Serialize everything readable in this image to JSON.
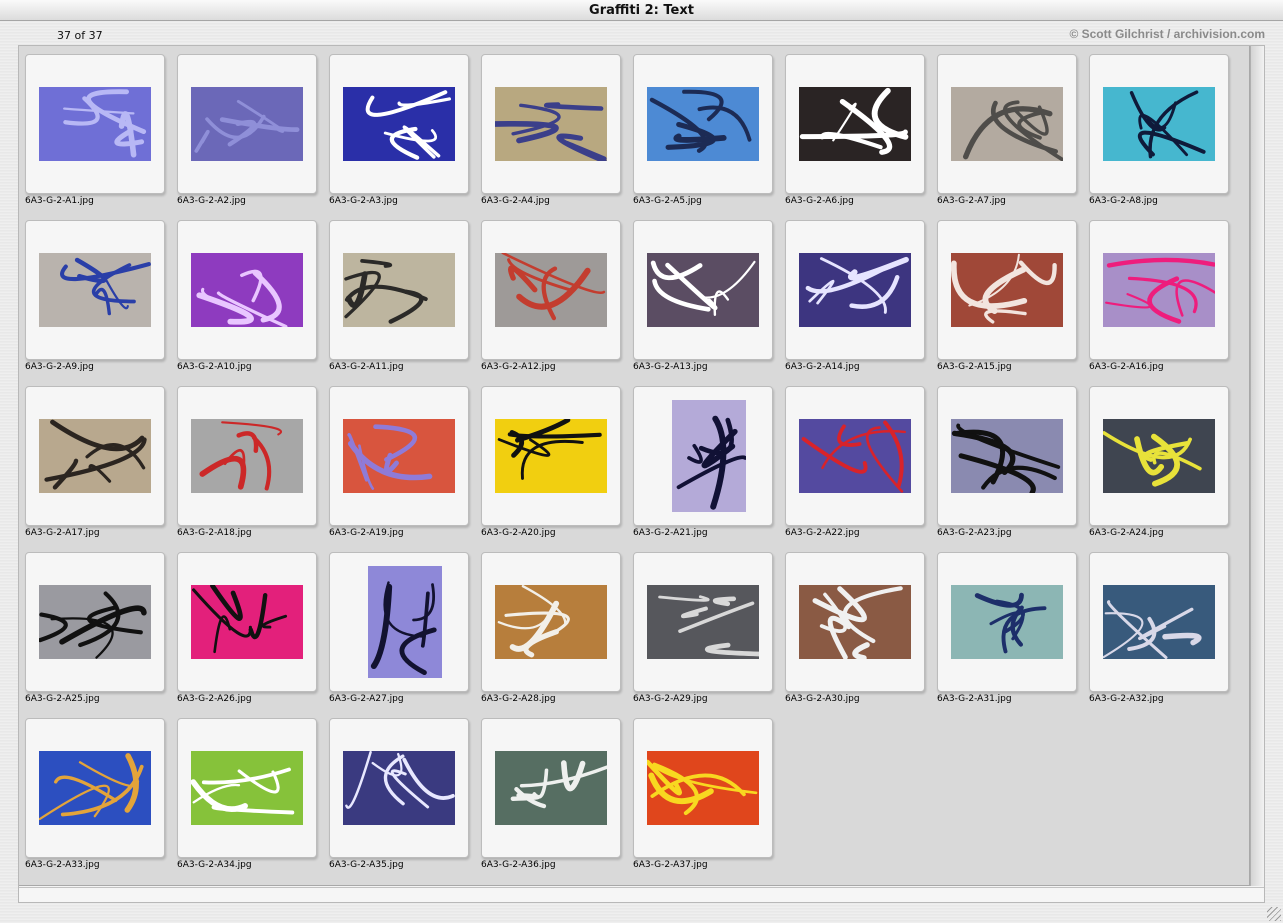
{
  "window": {
    "title": "Graffiti 2: Text"
  },
  "header": {
    "count": "37 of 37",
    "credit": "© Scott Gilchrist / archivision.com"
  },
  "thumbnails": [
    {
      "label": "6A3-G-2-A1.jpg",
      "bg": "#6f6fd6",
      "fg": "#b8b8f5",
      "orient": "land"
    },
    {
      "label": "6A3-G-2-A2.jpg",
      "bg": "#6b68b8",
      "fg": "#8f8fd8",
      "orient": "land"
    },
    {
      "label": "6A3-G-2-A3.jpg",
      "bg": "#2a2fa8",
      "fg": "#ffffff",
      "orient": "land"
    },
    {
      "label": "6A3-G-2-A4.jpg",
      "bg": "#b8a880",
      "fg": "#3b3f8a",
      "orient": "land"
    },
    {
      "label": "6A3-G-2-A5.jpg",
      "bg": "#4d8ad4",
      "fg": "#1c2b55",
      "orient": "land"
    },
    {
      "label": "6A3-G-2-A6.jpg",
      "bg": "#2a2424",
      "fg": "#ffffff",
      "orient": "land"
    },
    {
      "label": "6A3-G-2-A7.jpg",
      "bg": "#b3aaa0",
      "fg": "#4f4d4a",
      "orient": "land"
    },
    {
      "label": "6A3-G-2-A8.jpg",
      "bg": "#46b7cf",
      "fg": "#0f1a3a",
      "orient": "land"
    },
    {
      "label": "6A3-G-2-A9.jpg",
      "bg": "#b9b3ad",
      "fg": "#2a3fa8",
      "orient": "land"
    },
    {
      "label": "6A3-G-2-A10.jpg",
      "bg": "#8e3bbf",
      "fg": "#e9c6ff",
      "orient": "land"
    },
    {
      "label": "6A3-G-2-A11.jpg",
      "bg": "#bdb59f",
      "fg": "#2b2a28",
      "orient": "land"
    },
    {
      "label": "6A3-G-2-A12.jpg",
      "bg": "#9e9a98",
      "fg": "#c33d2f",
      "orient": "land"
    },
    {
      "label": "6A3-G-2-A13.jpg",
      "bg": "#5b4d63",
      "fg": "#ffffff",
      "orient": "land"
    },
    {
      "label": "6A3-G-2-A14.jpg",
      "bg": "#3d3580",
      "fg": "#e6e4ff",
      "orient": "land"
    },
    {
      "label": "6A3-G-2-A15.jpg",
      "bg": "#a04838",
      "fg": "#f2e4de",
      "orient": "land"
    },
    {
      "label": "6A3-G-2-A16.jpg",
      "bg": "#a88fc8",
      "fg": "#ee1d7d",
      "orient": "land"
    },
    {
      "label": "6A3-G-2-A17.jpg",
      "bg": "#b8a88e",
      "fg": "#2b2520",
      "orient": "land"
    },
    {
      "label": "6A3-G-2-A18.jpg",
      "bg": "#a7a7a7",
      "fg": "#cc2828",
      "orient": "land"
    },
    {
      "label": "6A3-G-2-A19.jpg",
      "bg": "#d8553e",
      "fg": "#8f7bd8",
      "orient": "land"
    },
    {
      "label": "6A3-G-2-A20.jpg",
      "bg": "#f1cf10",
      "fg": "#111111",
      "orient": "land"
    },
    {
      "label": "6A3-G-2-A21.jpg",
      "bg": "#b4aad8",
      "fg": "#111135",
      "orient": "port"
    },
    {
      "label": "6A3-G-2-A22.jpg",
      "bg": "#544aa0",
      "fg": "#d8232a",
      "orient": "land"
    },
    {
      "label": "6A3-G-2-A23.jpg",
      "bg": "#8a8ab0",
      "fg": "#111111",
      "orient": "land"
    },
    {
      "label": "6A3-G-2-A24.jpg",
      "bg": "#3f4550",
      "fg": "#e8e23a",
      "orient": "land"
    },
    {
      "label": "6A3-G-2-A25.jpg",
      "bg": "#9a9aa0",
      "fg": "#111111",
      "orient": "land"
    },
    {
      "label": "6A3-G-2-A26.jpg",
      "bg": "#e3207b",
      "fg": "#111111",
      "orient": "land"
    },
    {
      "label": "6A3-G-2-A27.jpg",
      "bg": "#8e88d8",
      "fg": "#121230",
      "orient": "port"
    },
    {
      "label": "6A3-G-2-A28.jpg",
      "bg": "#b77e3c",
      "fg": "#f2efe8",
      "orient": "land"
    },
    {
      "label": "6A3-G-2-A29.jpg",
      "bg": "#56575c",
      "fg": "#d8d8d8",
      "orient": "land"
    },
    {
      "label": "6A3-G-2-A30.jpg",
      "bg": "#8a5a44",
      "fg": "#f0f0f0",
      "orient": "land"
    },
    {
      "label": "6A3-G-2-A31.jpg",
      "bg": "#8cb6b4",
      "fg": "#1d2f6a",
      "orient": "land"
    },
    {
      "label": "6A3-G-2-A32.jpg",
      "bg": "#385a7c",
      "fg": "#d8d8e8",
      "orient": "land"
    },
    {
      "label": "6A3-G-2-A33.jpg",
      "bg": "#2c4fc0",
      "fg": "#e3a43a",
      "orient": "land"
    },
    {
      "label": "6A3-G-2-A34.jpg",
      "bg": "#86c23a",
      "fg": "#ffffff",
      "orient": "land"
    },
    {
      "label": "6A3-G-2-A35.jpg",
      "bg": "#3a3a80",
      "fg": "#e8e8ff",
      "orient": "land"
    },
    {
      "label": "6A3-G-2-A36.jpg",
      "bg": "#566e62",
      "fg": "#eef0ee",
      "orient": "land"
    },
    {
      "label": "6A3-G-2-A37.jpg",
      "bg": "#e0461c",
      "fg": "#f8d820",
      "orient": "land"
    }
  ]
}
